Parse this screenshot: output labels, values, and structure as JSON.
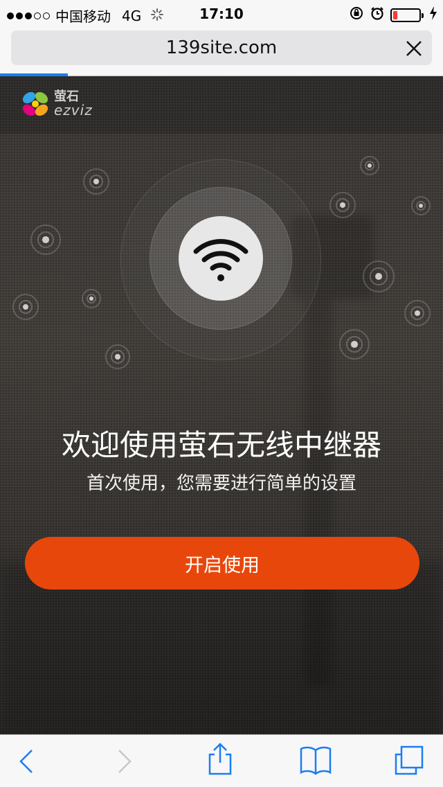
{
  "status_bar": {
    "carrier": "中国移动",
    "network": "4G",
    "time": "17:10",
    "signal_bars_filled": 3,
    "signal_bars_total": 5,
    "battery_level": 0.18,
    "battery_color": "#ff3b30",
    "icons": [
      "loading-spinner-icon",
      "rotation-lock-icon",
      "alarm-icon",
      "battery-icon",
      "charging-bolt-icon"
    ]
  },
  "browser": {
    "url": "139site.com",
    "load_progress": 0.15,
    "accent": "#1a7df1"
  },
  "app": {
    "logo_cn": "萤石",
    "logo_en": "ezviz",
    "title": "欢迎使用萤石无线中继器",
    "subtitle": "首次使用，您需要进行简单的设置",
    "start_button": "开启使用",
    "button_color": "#e8470b"
  },
  "toolbar": {
    "icons": [
      "back-icon",
      "forward-icon",
      "share-icon",
      "bookmarks-icon",
      "tabs-icon"
    ]
  }
}
